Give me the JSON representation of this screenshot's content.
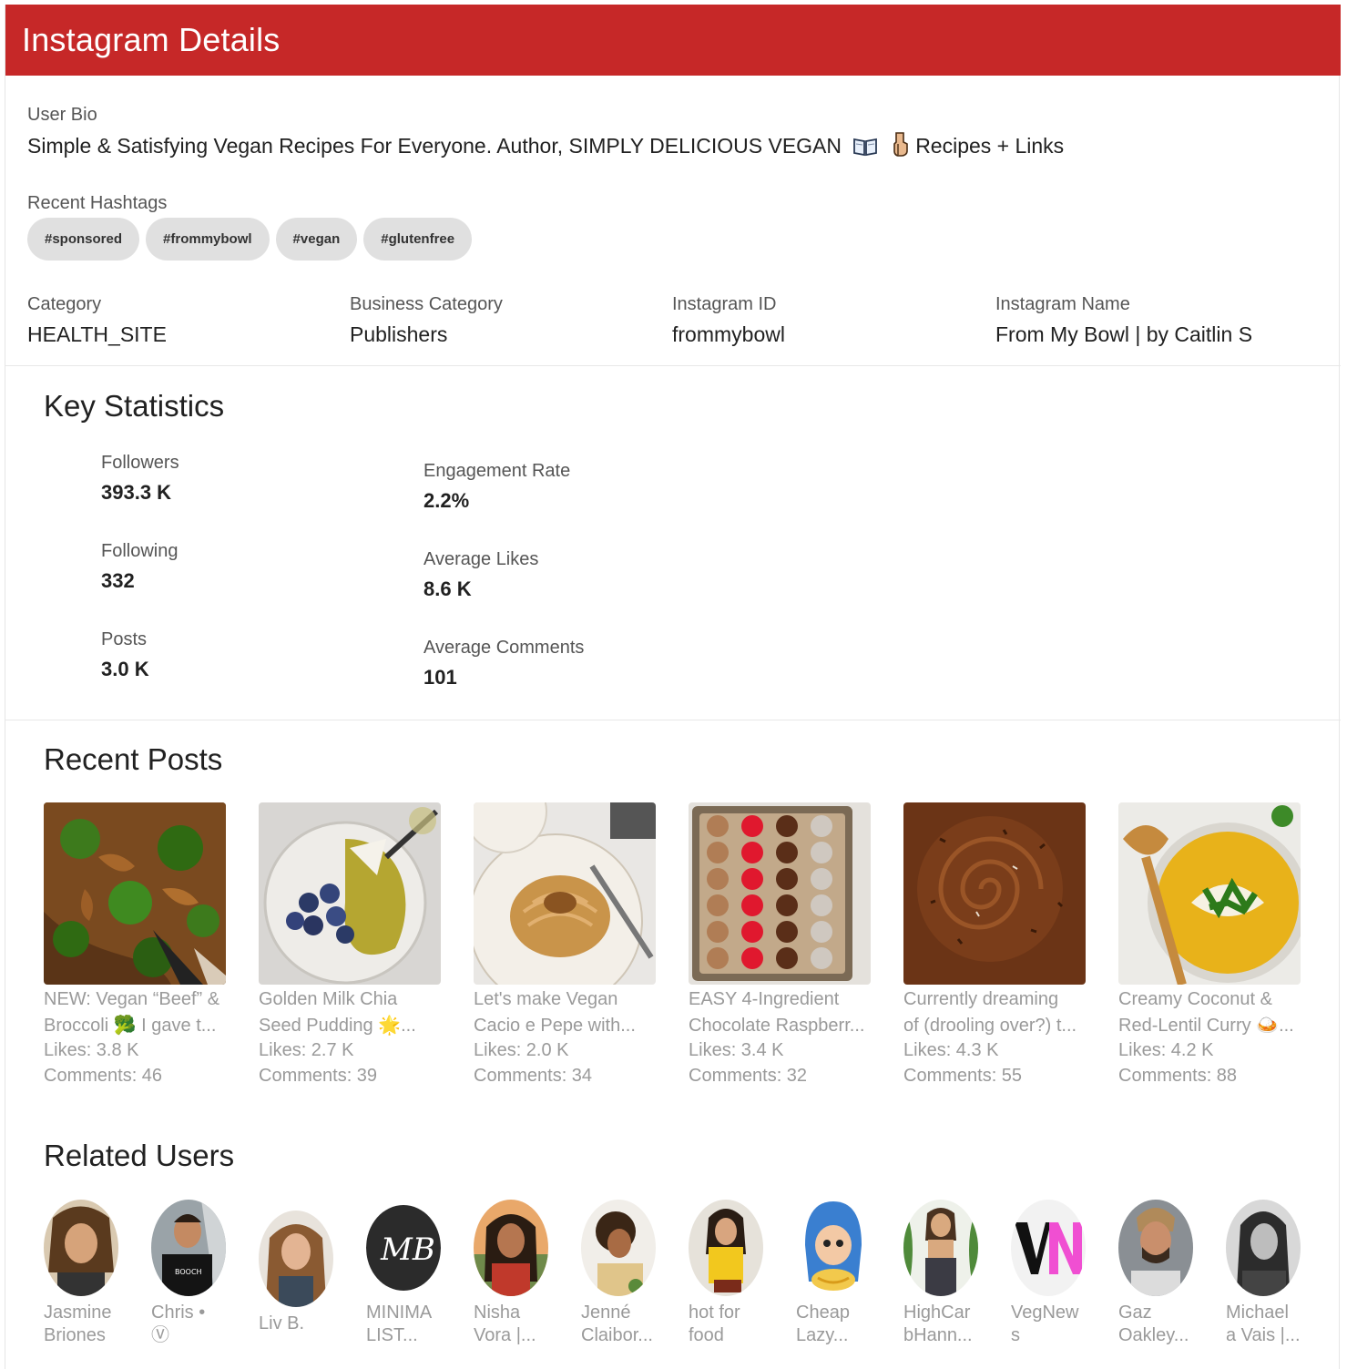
{
  "header": {
    "title": "Instagram Details"
  },
  "bio": {
    "label": "User Bio",
    "text_before": "Simple & Satisfying Vegan Recipes For Everyone. Author, SIMPLY DELICIOUS VEGAN",
    "text_after": "Recipes + Links",
    "icons": [
      "open-book-icon",
      "pointing-down-icon"
    ]
  },
  "hashtags": {
    "label": "Recent Hashtags",
    "items": [
      "#sponsored",
      "#frommybowl",
      "#vegan",
      "#glutenfree"
    ]
  },
  "details": [
    {
      "label": "Category",
      "value": "HEALTH_SITE"
    },
    {
      "label": "Business Category",
      "value": "Publishers"
    },
    {
      "label": "Instagram ID",
      "value": "frommybowl"
    },
    {
      "label": "Instagram Name",
      "value": "From My Bowl | by Caitlin S"
    }
  ],
  "key_statistics": {
    "title": "Key Statistics",
    "followers": {
      "label": "Followers",
      "value": "393.3 K"
    },
    "following": {
      "label": "Following",
      "value": "332"
    },
    "posts": {
      "label": "Posts",
      "value": "3.0 K"
    },
    "engagement": {
      "label": "Engagement Rate",
      "value": "2.2%"
    },
    "avg_likes": {
      "label": "Average Likes",
      "value": "8.6 K"
    },
    "avg_comments": {
      "label": "Average Comments",
      "value": "101"
    }
  },
  "recent_posts": {
    "title": "Recent Posts",
    "items": [
      {
        "line1": "NEW: Vegan “Beef” &",
        "line2": "Broccoli 🥦 I gave t...",
        "likes": "Likes: 3.8 K",
        "comments": "Comments: 46"
      },
      {
        "line1": "Golden Milk Chia",
        "line2": "Seed Pudding 🌟...",
        "likes": "Likes: 2.7 K",
        "comments": "Comments: 39"
      },
      {
        "line1": "Let's make Vegan",
        "line2": "Cacio e Pepe with...",
        "likes": "Likes: 2.0 K",
        "comments": "Comments: 34"
      },
      {
        "line1": "EASY 4-Ingredient",
        "line2": "Chocolate Raspberr...",
        "likes": "Likes: 3.4 K",
        "comments": "Comments: 32"
      },
      {
        "line1": "Currently dreaming",
        "line2": "of (drooling over?) t...",
        "likes": "Likes: 4.3 K",
        "comments": "Comments: 55"
      },
      {
        "line1": "Creamy Coconut &",
        "line2": "Red-Lentil Curry 🍛...",
        "likes": "Likes: 4.2 K",
        "comments": "Comments: 88"
      }
    ]
  },
  "related_users": {
    "title": "Related Users",
    "items": [
      {
        "line1": "Jasmine",
        "line2": "Briones"
      },
      {
        "line1": "Chris •",
        "line2": "Ⓥ"
      },
      {
        "line1": "Liv B.",
        "line2": ""
      },
      {
        "line1": "MINIMA",
        "line2": "LIST..."
      },
      {
        "line1": "Nisha",
        "line2": "Vora |..."
      },
      {
        "line1": "Jenné",
        "line2": "Claibor..."
      },
      {
        "line1": "hot for",
        "line2": "food"
      },
      {
        "line1": "Cheap",
        "line2": "Lazy..."
      },
      {
        "line1": "HighCar",
        "line2": "bHann..."
      },
      {
        "line1": "VegNew",
        "line2": "s"
      },
      {
        "line1": "Gaz",
        "line2": "Oakley..."
      },
      {
        "line1": "Michael",
        "line2": "a Vais |..."
      }
    ]
  },
  "colors": {
    "header": "#c62828",
    "chip": "#e0e0e0",
    "muted_text": "#9a9a9a"
  }
}
